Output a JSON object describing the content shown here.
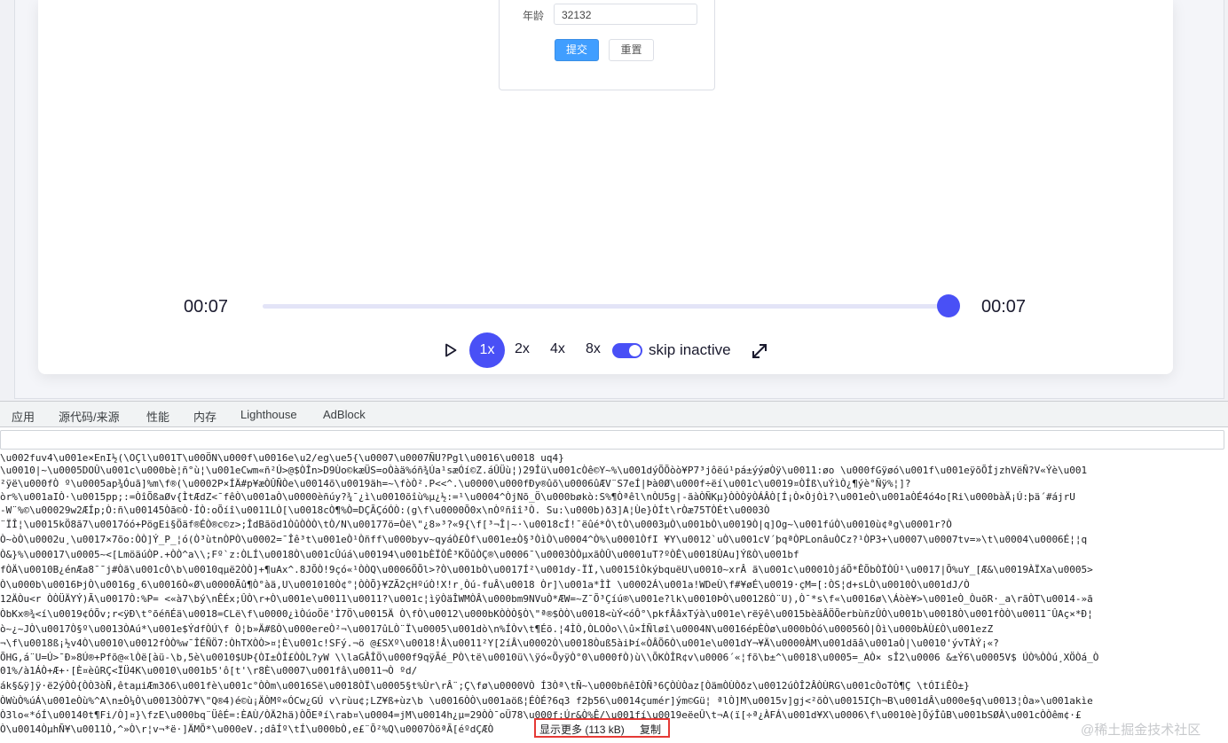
{
  "form": {
    "age_label": "年龄",
    "age_value": "32132",
    "submit_label": "提交",
    "reset_label": "重置"
  },
  "player": {
    "current_time": "00:07",
    "total_time": "00:07",
    "progress": 1.0,
    "speeds": [
      "1x",
      "2x",
      "4x",
      "8x"
    ],
    "active_speed": "1x",
    "skip_inactive_label": "skip inactive",
    "skip_inactive_on": true,
    "accent_color": "#4950f6"
  },
  "devtools": {
    "tabs": [
      "应用",
      "源代码/来源",
      "性能",
      "内存",
      "Lighthouse",
      "AdBlock"
    ]
  },
  "console": {
    "lines": [
      "\\u002fuv4\\u001e×EnI½(\\OÇl\\u001T\\u00ÖN\\u000f\\u0016e\\u2/eg\\ue5{\\u0007\\u0007ÑU?Pgl\\u0016\\u0018 uq4}",
      "\\u0010|~\\u0005DOÛ\\u001c\\u000bè¦ñ°ù¦\\u001eCwm«ñ²Ú>@$ÒÎn>D9Ùo©kæÜS=oÒàä%óñ¾Úa¹sæÓí©Z.áÛÜù¦)29Îü\\u001cÒê©Y~%\\u001dýÕÕòò¥P7³jôëú¹pá±ýýøÒÿ\\u0011:øo \\u000fGÿøó\\u001f\\u001eÿõÕÍjzhVëÑ?V«Ýè\\u001",
      "²ÿë\\u000fÒ º\\u0005ap¾Óuã]%m\\f®(\\u0002P×ÍÄ#p¥æÒÛÑÒe\\u0014õ\\u0019äh=~\\fòÒ².P<<^.\\u0000\\u000fÐy®ûõ\\u0006ûÆV¨S7eÍ|Þà0Ø\\u000f÷ëí\\u001c\\u0019¤ÒÍß\\uÝìÒ¿¶ýè°Ñÿ%¦]?",
      "òr%\\u001aIÒ·\\u0015pp;:=ÒîÕßaØv{ÌtÆdZ<¯fêÒ\\u001aÒ\\u0000èñúy?¾¯¿ì\\u0010õîù%µ¿½:=¹\\u0004^ÒjNõ_Ö\\u000bøkò:S%¶Òªêl\\nÒU5g|-ãàÒÑKµ}ÒÒÒÿÒÁÂÒ[Í¡Ò×ÒjÒì?\\u001eÒ\\u001aÒÉ4ó4o[Ri\\u000bàÄ¡Ú:þä´#ájrU",
      "-W¨%©\\u00029w2ÆÍp;Ò:ñ\\u00145Òã©Ò·ÍÒ:oÕíî\\u0011LÒ[\\u0018cÒ¶%Ò=DÇÃÇóÓÒ:(g\\f\\u0000Õ0x\\nÒºñîî³Ò. Su:\\u000b)ð3]A¦Ùe}ÒÍt\\rÒæ75TÒÉt\\u0003Ò",
      "¨ÏÎ¦\\u0015kÖ8ã7\\u0017óó+PögEi§Öäf®ÉÒ®c©z>;ÎdBãöd1ÒûÒÒÒ\\tÒ/N\\u00177ö=Òë\\\"¿8»³?«9{\\f[³¬Î|~·\\u0018cÍ!¯ëûé*Ò\\tÒ\\u0003µÒ\\u001bÒ\\u0019Ò|q]Og~\\u001fúÒ\\u0010ù¢ªg\\u0001r?Ò",
      "Ò~òÒ\\u0002u¸\\u0017×7õo:ÒÒ]Ý_P_¦ó(Ò³ùtnÒPÒ\\u0002=¯Îê³t\\u001eÒ¹Òñff\\u000byv~qyáÒ£Òf\\u001e±Ò§³ÒìÒ\\u0004^Ò%\\u0001ÒfI ¥Y\\u0012`uÒ\\u001cV´þqªÒPLonâuÒCz?¹ÒP3+\\u0007\\u0007tv=»\\t\\u0004\\u0006É¦¦q",
      "Ò&}%\\u00017\\u0005~<[LmöäúÒP.+ÒÒ^a\\\\;Fº`z:ÒLÍ\\u0018Ò\\u001cÛúá\\u00194\\u001bÈÏÒÊ³KÖûÒÇ®\\u0006¯\\u0003ÒÒµxãÒÛ\\u0001uT?ºÒÊ\\u0018ÙAu]ÝßÒ\\u001bf",
      "fÒÄ\\u0010B¿énÆa8¯¯j#Òã\\u001cÒ\\b\\u0010qµë2ÒÒ]+¶uAx^.8JÕÒ!9çó«¹ÒÒQ\\u0006ÕÕl>?Ò\\u001bÒ\\u0017Í²\\u001dy-ÏÏ,\\u0015îÒkýbquëU\\u0010~xrÂ ã\\u001c\\u0001ÒjáÕ*ÊÕbÒÏÒÛ¹\\u0017|Õ%uY_[Æ&\\u0019ÀÏXa\\u0005>",
      "Ò\\u000b\\u0016ÞjÒ\\u0016g¸6\\u0016Ò«Ø\\u0000Ãû¶Ò°àä,U\\u001010Ò¢°¦ÒÒÕ}¥ZÃ2çHºúÒ!X!r¸Òú-fuÂ\\u0018 Òr]\\u001a*ÌÌ \\u0002Á\\u001a!WDeÙ\\f#¥øÉ\\u0019·çM=[:ÒS¦d+sLÒ\\u0010Ò\\u001dJ/Ò",
      "12ÄÒu<r ÒÒÜÄYÝ)Ã\\u0017Ò:%P= <«à7\\bý\\nÊÉx;ÛÒ\\r+Ò\\u001e\\u0011\\u0011?\\u001c¦ìÿÒäÎWMÒÂ\\u000bm9NVuÒ*ÆW=~Z¯Õ³Çíú®\\u001e?lk\\u0010ÞÒ\\u0012ßÒ¨U),Ò¯*s\\f«\\u0016ø\\\\Áòè¥>\\u001eÒ_ÒuõR·_a\\rãÒT\\u0014-»ã",
      "ÒbKx®¾<í\\u0019¢ÓÕv;r<ÿÐ\\t°õéñÉä\\u0018=CLë\\f\\u0000¿ìÒúoÖë'Ì7Ö\\u0015Ä Ò\\fÒ\\u0012\\u000bKÒÒÒ§Ò\\\"ª®$ÒÒ\\u0018<ùÝ<óÔ°\\pkfÂâxTýà\\u001e\\rëÿê\\u0015bèäÂÖÕerbùñzÛÒ\\u001b\\u0018Ò\\u001fÒÒ\\u0011¯ÛAç×*Ð¦",
      "ò~¿~JÒ\\u0017Ò§º\\u0013ÒAú*\\u001e$ÝdfÒÚ\\f Ò¦b»Ä#ßÒ\\u000ereÒ²¬\\u0017ûLÒ¨Ï\\u0005\\u001dò\\n%ÍÒv\\t¶Éõ.¦4ÌÒ,ÒLOÒo\\\\û×ÍÑløî\\u0004N\\u0016épÈÒø\\u000bÒó\\u00056Ò|Òì\\u000bÀÙ£Ò\\u001ezZ",
      "¬\\f\\u0018ß¡½v4Ò\\u0010\\u0012fÒÒ%w¯ÎÉÑÖ7:ÒhTXÒÒ>¤¦È\\u001c!SFý.¬ö @£SXº\\u0018!Â\\u0011²Y[2íÂ\\u0002Ò\\u0018Òuß5àiÞí«ÒÂÕ6Ò\\u001e\\u001dY¬¥Ä\\u0000ÀM\\u001dãâ\\u001aÒ|\\u0010'ývTÀÝ¡«?",
      "ÕHG,á¨U=Ú>¯Ð»8Ú®+Pfõ@«lÒë[àü-\\b,5è\\u0010$UÞ{ÒI±ÒÍ£ÒÒL?yW \\\\laGÂÎÖ\\u000f9qÿÃé_PÒ\\të\\u0010ü\\\\ÿó«ÕyÿÒ°0\\u000fÒ)ù\\\\ÕKÒÎR¢v\\u0006´«¦fõ\\b±^\\u0018\\u0005=_AÒ× sÎ2\\u0006 &±Ý6\\u0005V$ ÚÒ%ÒÒú¸XÖÒá_Ò",
      "01%/à1ÁÒ+Æ+·[È¤èûRÇ<ÏÜ4K\\u0010\\u001b5'ô[t'\\r8È\\u0007\\u001fâ\\u0011¬Ò ºd/",
      "ák§&ÿ]ÿ·ë2ýÒÒ{ÒÒ3òÑ,êtaµiÆm3ð6\\u001fè\\u001c°ÒÒm\\u0016Së\\u0018ÒÏ\\u0005§t%Ùr\\rÂ¨;Ç\\fø\\u0000VÒ Í3Òª\\tÑ~\\u000bñêIÒÑ³6ÇÒÙÒaz[ÒämÒÙÒðz\\u0012úÒÎ2ÂÒÙRG\\u001cÒoTÒ¶Ç \\tÓIiÊÒ±}",
      "ÒWùÒ%úÁ\\u001eÒù%^A\\n±Ò¼Ò\\u0013ÒÒ7¥\\\"Q®4)é©ù¡ÄÒMº«ÓCw¿GÚ v\\rùu¢;LZ¥ß+ùz\\b \\u0016ÒÒ\\u001aöß¦ÉÒÉ?6q3 f2þ56\\u0014çumér]ým©Gü¦ ªlÒ]M\\u0015v]gj<²õÒ\\u0015IÇh¬B\\u001dÂ\\u000e§q\\u0013¦Òa»\\u001akìe",
      "Ò3lo«*óÍ\\u00140t¶Fi/Ò]¤}\\fzE\\u000bq¨ÜêÉ=:ÈAÙ/ÒÄ2hä)ÒÕEªí\\rab¤\\u0004=jM\\u0014h¿µ=29ÒÒ¯oÜ78\\u000f:Úr&Ò%Ê/\\u001fí\\u0019eëeÛ\\t¬A(ï[÷ª¿ÀFÁ\\u001d¥X\\u0006\\f\\u0010è]ÕýÎûB\\u001bSØÀ\\u001cÒÒêm¢·£",
      "Ò\\u0014ÒµhÑ¥\\u0011Ò,^»Ò\\r¦v¬*ë·]ÄMÕ*\\u000eV.;dâÍº\\tÍ\\u000bÒ,e£¨Õ²%Q\\u0007ÒöªÃ[éºdÇÆÒ"
    ],
    "show_more_label": "显示更多 (113 kB)",
    "copy_label": "复制"
  },
  "watermark": "@稀土掘金技术社区"
}
